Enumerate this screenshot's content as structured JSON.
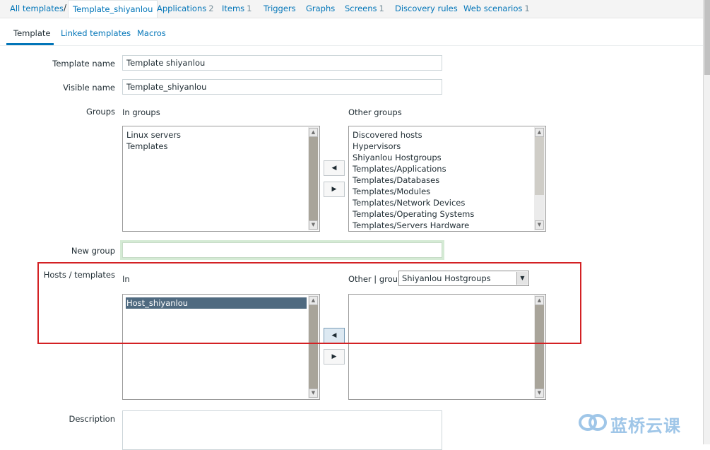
{
  "nav": {
    "all_templates": "All templates",
    "separator": "/",
    "current": "Template_shiyanlou",
    "applications": "Applications",
    "applications_count": "2",
    "items": "Items",
    "items_count": "1",
    "triggers": "Triggers",
    "graphs": "Graphs",
    "screens": "Screens",
    "screens_count": "1",
    "discovery_rules": "Discovery rules",
    "web_scenarios": "Web scenarios",
    "web_scenarios_count": "1"
  },
  "tabs": [
    {
      "label": "Template",
      "active": true
    },
    {
      "label": "Linked templates",
      "active": false
    },
    {
      "label": "Macros",
      "active": false
    }
  ],
  "form": {
    "template_name_label": "Template name",
    "template_name_value": "Template shiyanlou",
    "visible_name_label": "Visible name",
    "visible_name_value": "Template_shiyanlou",
    "groups_label": "Groups",
    "in_groups_label": "In groups",
    "other_groups_label": "Other groups",
    "in_groups": [
      "Linux servers",
      "Templates"
    ],
    "other_groups": [
      "Discovered hosts",
      "Hypervisors",
      "Shiyanlou Hostgroups",
      "Templates/Applications",
      "Templates/Databases",
      "Templates/Modules",
      "Templates/Network Devices",
      "Templates/Operating Systems",
      "Templates/Servers Hardware"
    ],
    "new_group_label": "New group",
    "new_group_value": "",
    "hosts_templates_label": "Hosts / templates",
    "in_label": "In",
    "other_group_label": "Other | group",
    "other_group_select": "Shiyanlou Hostgroups",
    "hosts_in": [
      {
        "label": "Host_shiyanlou",
        "selected": true
      }
    ],
    "hosts_other": [],
    "description_label": "Description",
    "description_value": ""
  },
  "icons": {
    "move_left": "◀",
    "move_right": "▶",
    "scroll_up": "▲",
    "scroll_down": "▼",
    "dropdown": "▼"
  },
  "watermark": {
    "text": "蓝桥云课"
  },
  "colors": {
    "link": "#0275b8",
    "annotation": "#d32124",
    "selected_row": "#4f6a80"
  }
}
